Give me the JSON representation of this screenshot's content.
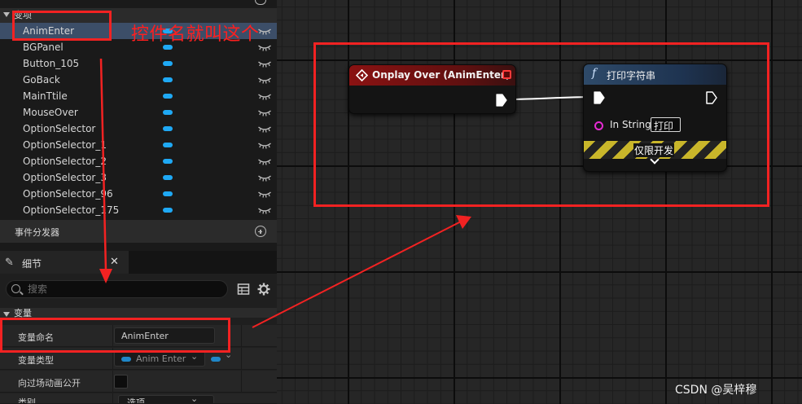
{
  "variables_section": {
    "title": "变项",
    "items": [
      {
        "name": "AnimEnter",
        "selected": true
      },
      {
        "name": "BGPanel"
      },
      {
        "name": "Button_105"
      },
      {
        "name": "GoBack"
      },
      {
        "name": "MainTtile"
      },
      {
        "name": "MouseOver"
      },
      {
        "name": "OptionSelector"
      },
      {
        "name": "OptionSelector_1"
      },
      {
        "name": "OptionSelector_2"
      },
      {
        "name": "OptionSelector_3"
      },
      {
        "name": "OptionSelector_96"
      },
      {
        "name": "OptionSelector_175"
      }
    ]
  },
  "dispatchers_section": {
    "title": "事件分发器"
  },
  "details_panel": {
    "tab_label": "细节",
    "search_placeholder": "搜索",
    "category_title": "变量",
    "rows": [
      {
        "label": "变量命名",
        "value": "AnimEnter"
      },
      {
        "label": "变量类型",
        "value": "Anim Enter"
      },
      {
        "label": "向过场动画公开",
        "checked": false
      },
      {
        "label": "类别",
        "value": "选项"
      }
    ]
  },
  "graph": {
    "event_node": {
      "title": "Onplay Over (AnimEnter)",
      "color": "#8a1212"
    },
    "function_node": {
      "title": "打印字符串",
      "pin_label": "In String",
      "pin_value": "打印",
      "dev_only_label": "仅限开发",
      "color": "#2e4a69"
    }
  },
  "annotation": {
    "text": "控件名就叫这个",
    "color": "#ff1f1f"
  },
  "watermark": "CSDN @吴梓穆",
  "colors": {
    "pill": "#1fa9f5",
    "exec_wire": "#ffffff",
    "string_pin": "#e62ad3"
  }
}
